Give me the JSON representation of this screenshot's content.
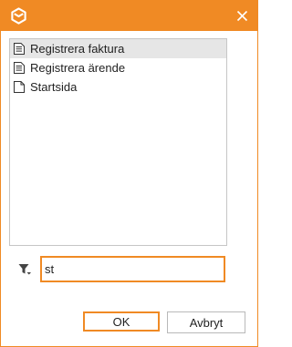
{
  "dialog": {
    "title_icon": "app-logo-icon",
    "close_icon": "close-icon",
    "accent_color": "#f08a24"
  },
  "list": {
    "selected_index": 0,
    "items": [
      {
        "label": "Registrera faktura",
        "icon": "document-lines-icon"
      },
      {
        "label": "Registrera ärende",
        "icon": "document-lines-icon"
      },
      {
        "label": "Startsida",
        "icon": "document-blank-icon"
      }
    ]
  },
  "filter": {
    "icon": "filter-icon",
    "value": "st"
  },
  "buttons": {
    "ok_label": "OK",
    "cancel_label": "Avbryt"
  }
}
